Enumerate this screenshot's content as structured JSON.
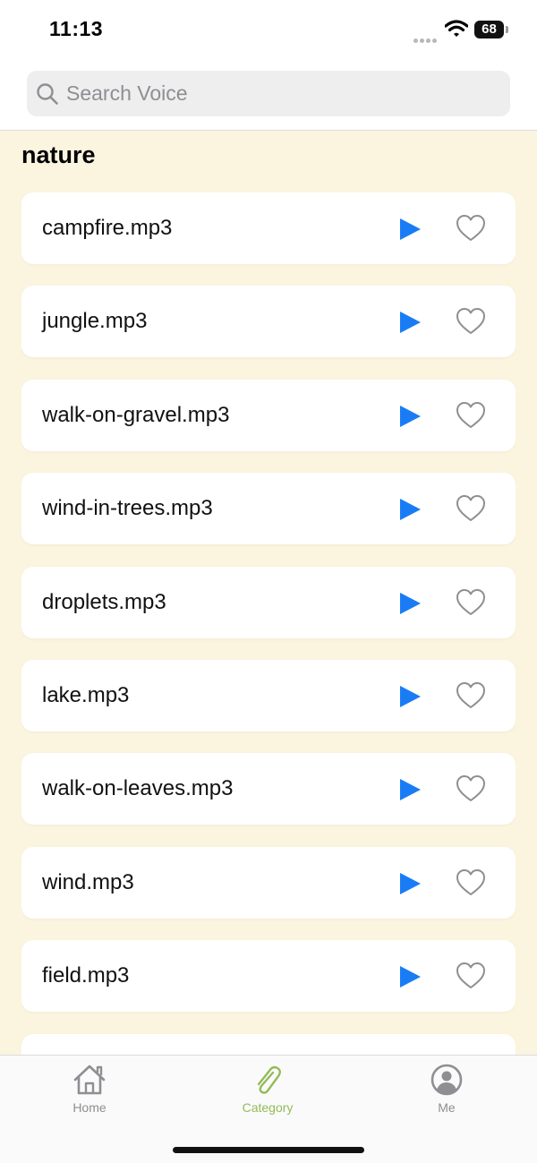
{
  "status": {
    "time": "11:13",
    "battery": "68"
  },
  "search": {
    "placeholder": "Search Voice"
  },
  "section": {
    "title": "nature"
  },
  "items": [
    {
      "name": "campfire.mp3"
    },
    {
      "name": "jungle.mp3"
    },
    {
      "name": "walk-on-gravel.mp3"
    },
    {
      "name": "wind-in-trees.mp3"
    },
    {
      "name": "droplets.mp3"
    },
    {
      "name": "lake.mp3"
    },
    {
      "name": "walk-on-leaves.mp3"
    },
    {
      "name": "wind.mp3"
    },
    {
      "name": "field.mp3"
    },
    {
      "name": ""
    }
  ],
  "tabs": [
    {
      "label": "Home",
      "icon": "house-icon",
      "active": false
    },
    {
      "label": "Category",
      "icon": "paperclip-icon",
      "active": true
    },
    {
      "label": "Me",
      "icon": "person-icon",
      "active": false
    }
  ],
  "colors": {
    "accent": "#94bb59",
    "play": "#1a7cf5",
    "background": "#fbf4df",
    "heart": "#8e8e93"
  }
}
